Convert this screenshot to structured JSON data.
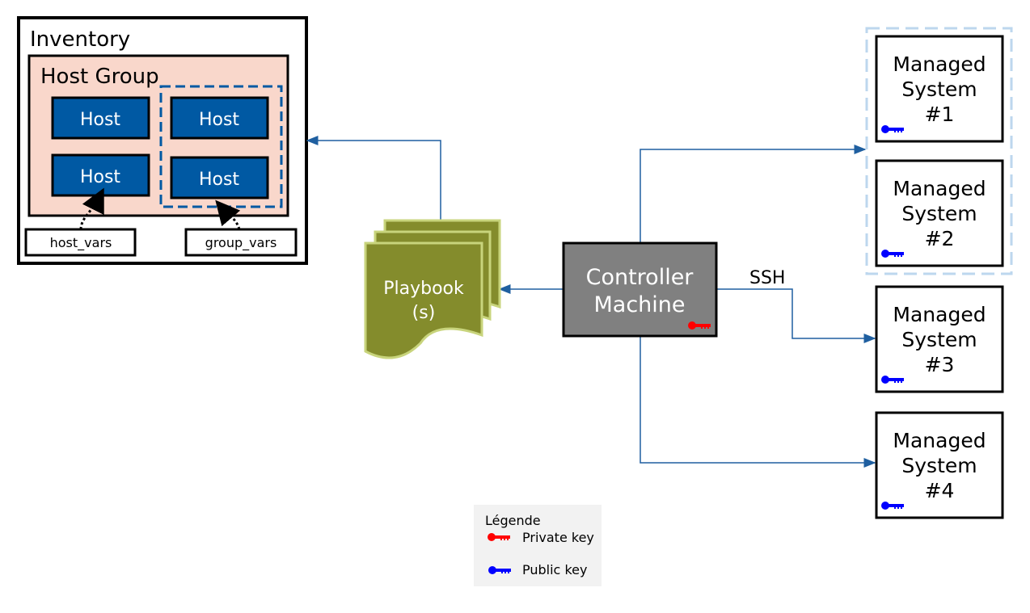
{
  "inventory": {
    "title": "Inventory",
    "group_title": "Host Group",
    "hosts": [
      "Host",
      "Host",
      "Host",
      "Host"
    ],
    "host_vars": "host_vars",
    "group_vars": "group_vars"
  },
  "playbook": {
    "line1": "Playbook",
    "line2": "(s)"
  },
  "controller": {
    "line1": "Controller",
    "line2": "Machine",
    "icon": "private-key-icon"
  },
  "connection_label": "SSH",
  "managed": [
    {
      "line1": "Managed",
      "line2": "System",
      "line3": "#1"
    },
    {
      "line1": "Managed",
      "line2": "System",
      "line3": "#2"
    },
    {
      "line1": "Managed",
      "line2": "System",
      "line3": "#3"
    },
    {
      "line1": "Managed",
      "line2": "System",
      "line3": "#4"
    }
  ],
  "legend": {
    "title": "Légende",
    "private": "Private key",
    "public": "Public key"
  },
  "colors": {
    "host": "#0059a3",
    "group": "#f9d7cb",
    "playbook": "#848c2c",
    "controller": "#808080",
    "private_key": "#ff0000",
    "public_key": "#0000ff",
    "line": "#1f5fa0"
  }
}
